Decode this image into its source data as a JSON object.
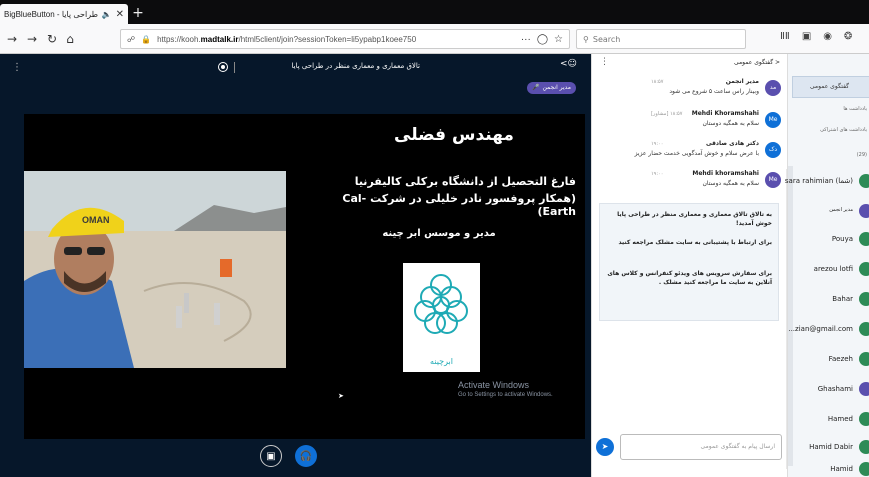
{
  "browser": {
    "tab_title": "BigBlueButton - طراحی پایا",
    "tab_audio_icon": "speaker-icon",
    "url_prefix": "https://kooh.",
    "url_domain": "madtalk.ir",
    "url_path": "/html5client/join?sessionToken=li5ypabp1koee750",
    "search_placeholder": "Search"
  },
  "presentation": {
    "session_title": "تالاق معماری و معماری منظر در طراحی پایا",
    "presenter_badge": "مدیر انجمن",
    "slide": {
      "name": "مهندس فضلی",
      "line1": "فارغ التحصیل از دانشگاه برکلی کالیفرنیا",
      "line2": "(همکار پروفسور نادر خلیلی در شرکت Cal-Earth)",
      "line3": "مدیر و موسس ابر چینه",
      "logo_caption": "ابرچینه",
      "photo_cap_text": "OMAN"
    },
    "watermark_title": "Activate Windows",
    "watermark_sub": "Go to Settings to activate Windows."
  },
  "chat": {
    "title": "گفتگوی عمومی",
    "messages": [
      {
        "initials": "مد",
        "color": "#5a4fae",
        "name": "مدیر انجمن",
        "meta": "۱۸:۵۷",
        "text": "وبینار راس ساعت ۵ شروع می شود"
      },
      {
        "initials": "Me",
        "color": "#0f70d7",
        "name": "Mehdi Khoramshahi",
        "meta": "[مشاور] ۱۸:۵۷",
        "text": "سلام به همگیه دوستان"
      },
      {
        "initials": "دک",
        "color": "#0f70d7",
        "name": "دکتر هادی صادقی",
        "meta": "۱۹:۰۰",
        "text": "با عرض سلام و خوش آمدگویی خدمت حضار عزیز"
      },
      {
        "initials": "Me",
        "color": "#5a4fae",
        "name": "Mehdi khoramshahi",
        "meta": "۱۹:۰۰",
        "text": "سلام به همگیه دوستان"
      }
    ],
    "welcome_1": "به تالاق تالاق معماری و معماری منظر در طراحی پایا خوش آمدید!",
    "welcome_2": "برای ارتباط با پشتیبانی به سایت مشلک مراجعه کنید",
    "welcome_3": "برای سفارش سرویس های ویدئو کنفرانس و کلاس های آنلاین به سایت ما مراجعه کنید مشلک .",
    "input_placeholder": "ارسال پیام به گفتگوی عمومی"
  },
  "users": {
    "chat_link": "گفتگوی عمومی",
    "notes_label": "یادداشت ها",
    "shared_notes": "یادداشت های اشتراکی",
    "count": "(29)",
    "list": [
      {
        "name": "sara rahimian (شما)",
        "color": "#2e8b57"
      },
      {
        "name": "مدیر انجمن",
        "color": "#5a4fae"
      },
      {
        "name": "Pouya",
        "color": "#2e8b57"
      },
      {
        "name": "arezou lotfi",
        "color": "#2e8b57"
      },
      {
        "name": "Bahar",
        "color": "#2e8b57"
      },
      {
        "name": "...zian@gmail.com",
        "color": "#2e8b57"
      },
      {
        "name": "Faezeh",
        "color": "#2e8b57"
      },
      {
        "name": "Ghashami",
        "color": "#5a4fae"
      },
      {
        "name": "Hamed",
        "color": "#2e8b57"
      },
      {
        "name": "Hamid Dabir",
        "color": "#2e8b57"
      },
      {
        "name": "Hamid",
        "color": "#2e8b57"
      }
    ]
  }
}
